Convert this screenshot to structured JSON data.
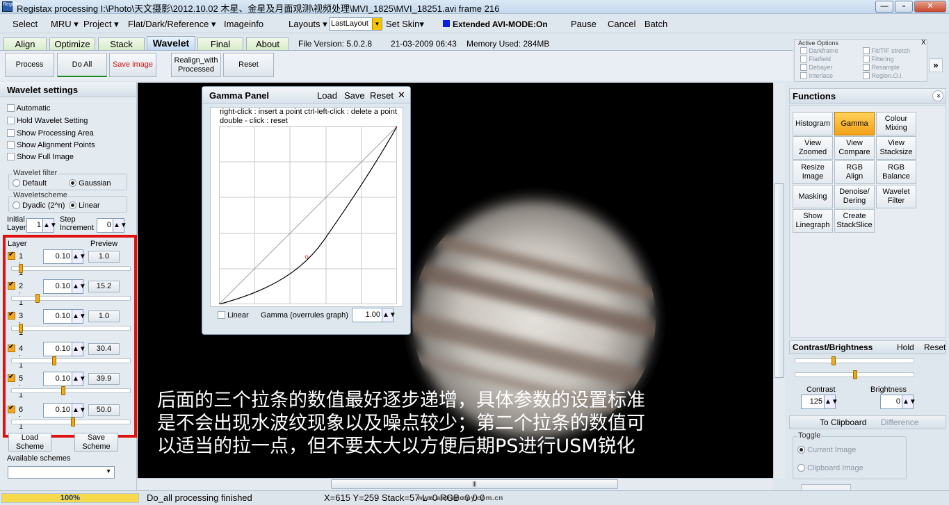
{
  "window": {
    "title": "Registax processing I:\\Photo\\天文摄影\\2012.10.02  木星、金星及月面观测\\视频处理\\MVI_1825\\MVI_18251.avi frame 216",
    "app_icon": "RegiStax",
    "btn_min": "—",
    "btn_max": "▫",
    "btn_close": "✕"
  },
  "menu": {
    "select": "Select",
    "mru": "MRU ▾",
    "project": "Project ▾",
    "flat": "Flat/Dark/Reference ▾",
    "imageinfo": "Imageinfo",
    "layouts": "Layouts ▾",
    "layout_value": "LastLayout",
    "set_skin": "Set Skin▾",
    "avi_mode": "Extended AVI-MODE:On",
    "pause": "Pause",
    "cancel": "Cancel",
    "batch": "Batch"
  },
  "tabs": [
    "Align",
    "Optimize",
    "Stack",
    "Wavelet",
    "Final",
    "About"
  ],
  "file_info": {
    "version": "File Version: 5.0.2.8",
    "date": "21-03-2009 06:43",
    "memory": "Memory Used: 284MB"
  },
  "toolbar": {
    "process": "Process",
    "do_all": "Do All",
    "save_image": "Save image",
    "realign_1": "Realign_with",
    "realign_2": "Processed",
    "reset": "Reset"
  },
  "active_options": {
    "title": "Active Options",
    "close": "X",
    "col1": [
      "Darkframe",
      "Flatfield",
      "Debayer",
      "Interlace"
    ],
    "col2": [
      "Fit/TIF stretch",
      "Filtering",
      "Resample",
      "Region.O.I."
    ],
    "expand": "»"
  },
  "wavelet_settings": {
    "title": "Wavelet settings",
    "options": [
      "Automatic",
      "Hold Wavelet Setting",
      "Show Processing Area",
      "Show Alignment Points",
      "Show Full Image"
    ],
    "filter_title": "Wavelet filter",
    "filter_default": "Default",
    "filter_gaussian": "Gaussian",
    "scheme_title": "Waveletscheme",
    "scheme_dyadic": "Dyadic (2^n)",
    "scheme_linear": "Linear",
    "initial_1": "Initial",
    "initial_2": "Layer",
    "initial_value": "1",
    "step_1": "Step",
    "step_2": "Increment",
    "step_value": "0",
    "layer_header": "Layer",
    "preview_header": "Preview",
    "layers": [
      {
        "label": "1 : 1",
        "value": "0.10",
        "preview": "1.0",
        "slider": 0.06
      },
      {
        "label": "2 : 1",
        "value": "0.10",
        "preview": "15.2",
        "slider": 0.2
      },
      {
        "label": "3 : 1",
        "value": "0.10",
        "preview": "1.0",
        "slider": 0.06
      },
      {
        "label": "4 : 1",
        "value": "0.10",
        "preview": "30.4",
        "slider": 0.34
      },
      {
        "label": "5 : 1",
        "value": "0.10",
        "preview": "39.9",
        "slider": 0.42
      },
      {
        "label": "6 : 1",
        "value": "0.10",
        "preview": "50.0",
        "slider": 0.5
      }
    ],
    "load_1": "Load",
    "load_2": "Scheme",
    "save_1": "Save",
    "save_2": "Scheme",
    "available_schemes": "Available schemes"
  },
  "gamma_panel": {
    "title": "Gamma Panel",
    "load": "Load",
    "save": "Save",
    "reset": "Reset",
    "close": "✕",
    "hint1": "right-click : insert a point   ctrl-left-click : delete a point",
    "hint2": "double - click : reset",
    "linear": "Linear",
    "gamma_label": "Gamma (overrules graph)",
    "gamma_value": "1.00"
  },
  "caption": {
    "line1": "后面的三个拉条的数值最好逐步递增，具体参数的设置标准",
    "line2": "是不会出现水波纹现象以及噪点较少；第二个拉条的数值可",
    "line3": "以适当的拉一点，但不要太大以方便后期PS进行USM锐化"
  },
  "functions": {
    "title": "Functions",
    "expand": "»",
    "buttons": [
      [
        "Histogram",
        ""
      ],
      [
        "Gamma",
        ""
      ],
      [
        "Colour",
        "Mixing"
      ],
      [
        "View",
        "Zoomed"
      ],
      [
        "View",
        "Compare"
      ],
      [
        "View",
        "Stacksize"
      ],
      [
        "Resize",
        "Image"
      ],
      [
        "RGB",
        "Align"
      ],
      [
        "RGB",
        "Balance"
      ],
      [
        "Masking",
        ""
      ],
      [
        "Denoise/",
        "Dering"
      ],
      [
        "Wavelet",
        "Filter"
      ],
      [
        "Show",
        "Linegraph"
      ],
      [
        "Create",
        "StackSlice"
      ]
    ]
  },
  "contrast_brightness": {
    "title": "Contrast/Brightness",
    "hold": "Hold",
    "reset": "Reset",
    "contrast_label": "Contrast",
    "contrast_value": "125",
    "brightness_label": "Brightness",
    "brightness_value": "0"
  },
  "clipboard": {
    "title": "To Clipboard",
    "difference": "Difference",
    "toggle": "Toggle",
    "current": "Current Image",
    "clipboard": "Clipboard Image"
  },
  "status": {
    "progress": "100%",
    "progress_value": 1.0,
    "message": "Do_all processing finished",
    "coords": "X=615 Y=259 Stack=57 L=0 RGB=0 0 0",
    "watermark": "www.astronomy.com.cn"
  }
}
